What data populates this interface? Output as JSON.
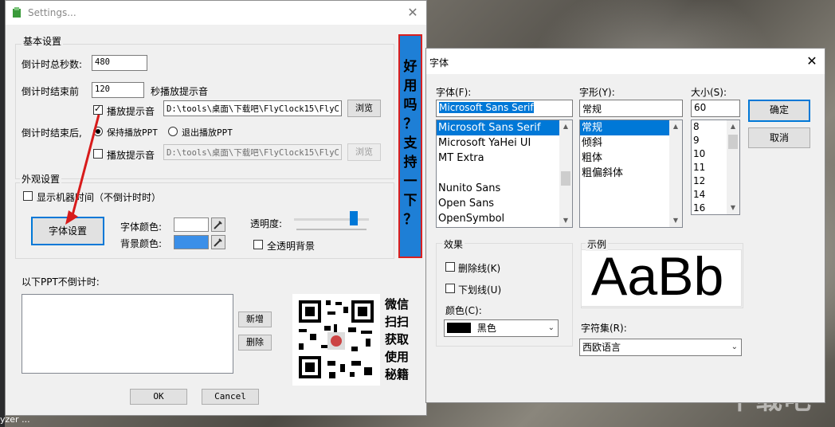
{
  "settings": {
    "title": "Settings...",
    "basic_group": "基本设置",
    "total_seconds_label": "倒计时总秒数:",
    "total_seconds_value": "480",
    "before_end_label": "倒计时结束前",
    "before_end_value": "120",
    "seconds_prompt_label": "秒播放提示音",
    "play_sound_1": "播放提示音",
    "sound_path_1": "D:\\tools\\桌面\\下载吧\\FlyClock15\\FlyC",
    "browse_1": "浏览",
    "after_end_label": "倒计时结束后,",
    "keep_playing": "保持播放PPT",
    "exit_playing": "退出播放PPT",
    "play_sound_2": "播放提示音",
    "sound_path_2": "D:\\tools\\桌面\\下载吧\\FlyClock15\\FlyC",
    "browse_2": "浏览",
    "appearance_group": "外观设置",
    "show_machine_time": "显示机器时间（不倒计时时）",
    "font_settings_button": "字体设置",
    "font_color_label": "字体颜色:",
    "bg_color_label": "背景颜色:",
    "opacity_label": "透明度:",
    "full_transparent": "全透明背景",
    "no_countdown_label": "以下PPT不倒计时:",
    "add_button": "新增",
    "delete_button": "删除",
    "ok_button": "OK",
    "cancel_button": "Cancel",
    "banner_chars": [
      "好",
      "用",
      "吗",
      "？",
      "支",
      "持",
      "一",
      "下",
      "？"
    ],
    "qr_chars": [
      "微信",
      "扫扫",
      "获取",
      "使用",
      "秘籍"
    ],
    "opacity": 0.85,
    "font_color": "#ffffff",
    "bg_color": "#3b8fe8"
  },
  "font_dialog": {
    "title": "字体",
    "font_label": "字体(F):",
    "font_value": "Microsoft Sans Serif",
    "fonts": [
      "Microsoft Sans Serif",
      "Microsoft YaHei UI",
      "MT Extra",
      "",
      "Nunito Sans",
      "Open Sans",
      "OpenSymbol"
    ],
    "style_label": "字形(Y):",
    "style_value": "常规",
    "styles": [
      "常规",
      "倾斜",
      "粗体",
      "粗偏斜体"
    ],
    "size_label": "大小(S):",
    "size_value": "60",
    "sizes": [
      "8",
      "9",
      "10",
      "11",
      "12",
      "14",
      "16"
    ],
    "ok_button": "确定",
    "cancel_button": "取消",
    "effects_group": "效果",
    "strikeout": "删除线(K)",
    "underline": "下划线(U)",
    "color_label": "颜色(C):",
    "color_value": "黑色",
    "sample_group": "示例",
    "sample_text": "AaBb",
    "charset_label": "字符集(R):",
    "charset_value": "西欧语言"
  },
  "desktop": {
    "taskbar_label": "yzer ...",
    "watermark": "下载吧"
  }
}
